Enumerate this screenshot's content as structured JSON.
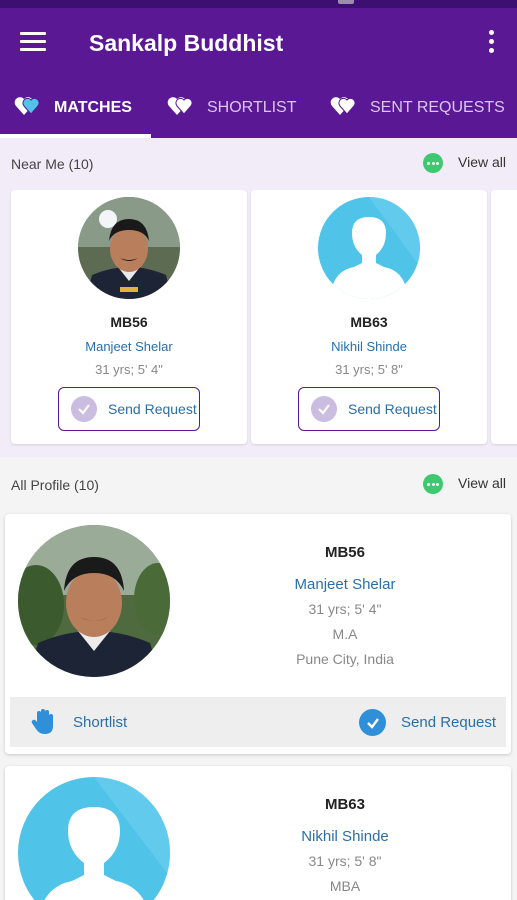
{
  "app": {
    "title": "Sankalp Buddhist"
  },
  "tabs": [
    {
      "label": "MATCHES",
      "active": true
    },
    {
      "label": "SHORTLIST",
      "active": false
    },
    {
      "label": "SENT REQUESTS",
      "active": false
    }
  ],
  "near_me": {
    "heading": "Near Me (10)",
    "view_all": "View all",
    "profiles": [
      {
        "id": "MB56",
        "name": "Manjeet Shelar",
        "meta": "31 yrs; 5' 4\"",
        "button": "Send Request",
        "photo": "profile-photo"
      },
      {
        "id": "MB63",
        "name": "Nikhil Shinde",
        "meta": "31 yrs; 5' 8\"",
        "button": "Send Request",
        "photo": "placeholder-avatar"
      }
    ]
  },
  "all_profiles": {
    "heading": "All Profile (10)",
    "view_all": "View all",
    "profiles": [
      {
        "id": "MB56",
        "name": "Manjeet Shelar",
        "meta": "31 yrs; 5' 4\"",
        "education": "M.A",
        "location": "Pune City, India",
        "shortlist_label": "Shortlist",
        "request_label": "Send Request",
        "photo": "profile-photo"
      },
      {
        "id": "MB63",
        "name": "Nikhil Shinde",
        "meta": "31 yrs; 5' 8\"",
        "education": "MBA",
        "photo": "placeholder-avatar"
      }
    ]
  },
  "colors": {
    "primary": "#5a1895",
    "accent_green": "#3ec971",
    "link_blue": "#2a6fa8",
    "avatar_placeholder": "#4fc3e8"
  },
  "icons": [
    "menu-icon",
    "more-vert-icon",
    "hearts-icon",
    "check-circle-icon",
    "hand-icon"
  ]
}
